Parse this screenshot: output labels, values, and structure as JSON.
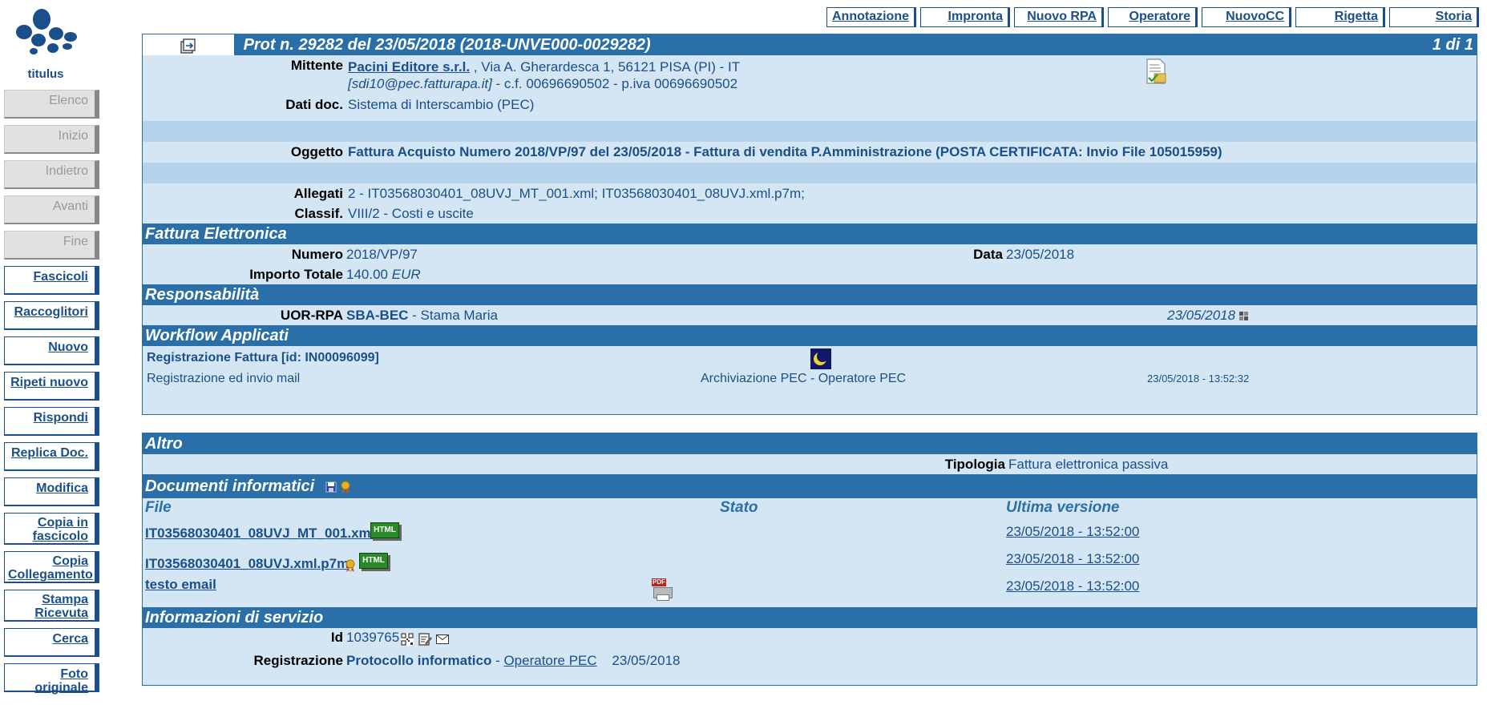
{
  "app": {
    "logo_text": "titulus"
  },
  "sidebar": {
    "disabled": [
      {
        "label": "Elenco"
      },
      {
        "label": "Inizio"
      },
      {
        "label": "Indietro"
      },
      {
        "label": "Avanti"
      },
      {
        "label": "Fine"
      }
    ],
    "actions": [
      {
        "label": "Fascicoli"
      },
      {
        "label": "Raccoglitori"
      },
      {
        "label": "Nuovo"
      },
      {
        "label": "Ripeti nuovo"
      },
      {
        "label": "Rispondi"
      },
      {
        "label": "Replica Doc."
      },
      {
        "label": "Modifica"
      },
      {
        "label": "Copia in fascicolo"
      },
      {
        "label": "Copia Collegamento"
      },
      {
        "label": "Stampa Ricevuta"
      },
      {
        "label": "Cerca"
      },
      {
        "label": "Foto originale"
      }
    ]
  },
  "toolbar": {
    "buttons": [
      {
        "label": "Annotazione"
      },
      {
        "label": "Impronta"
      },
      {
        "label": "Nuovo RPA"
      },
      {
        "label": "Operatore"
      },
      {
        "label": "NuovoCC"
      },
      {
        "label": "Rigetta"
      },
      {
        "label": "Storia"
      }
    ]
  },
  "record": {
    "title": "Prot n. 29282 del 23/05/2018  (2018-UNVE000-0029282)",
    "pager": "1 di 1",
    "mittente_label": "Mittente",
    "mittente_name": "Pacini Editore s.r.l.",
    "mittente_address": ", Via A. Gherardesca 1, 56121 PISA (PI) - IT",
    "mittente_email": "[sdi10@pec.fatturapa.it]",
    "mittente_ids": " - c.f. 00696690502 - p.iva 00696690502",
    "datidoc_label": "Dati doc.",
    "datidoc_value": "Sistema di Interscambio (PEC)",
    "oggetto_label": "Oggetto",
    "oggetto_value": "Fattura Acquisto Numero 2018/VP/97 del 23/05/2018 - Fattura di vendita P.Amministrazione (POSTA CERTIFICATA: Invio File 105015959)",
    "allegati_label": "Allegati",
    "allegati_value": "2 -  IT03568030401_08UVJ_MT_001.xml; IT03568030401_08UVJ.xml.p7m;",
    "classif_label": "Classif.",
    "classif_value": "VIII/2 - Costi e uscite"
  },
  "fattura": {
    "header": "Fattura Elettronica",
    "numero_label": "Numero",
    "numero_value": "2018/VP/97",
    "data_label": "Data",
    "data_value": "23/05/2018",
    "importo_label": "Importo Totale",
    "importo_value": "140.00",
    "importo_currency": "EUR"
  },
  "responsabilita": {
    "header": "Responsabilità",
    "uor_label": "UOR-RPA",
    "uor_code": "SBA-BEC",
    "uor_person": " - Stama Maria",
    "date": "23/05/2018"
  },
  "workflow": {
    "header": "Workflow Applicati",
    "name": "Registrazione Fattura [id: IN00096099]",
    "step": "Registrazione ed invio mail",
    "operator": "Archiviazione PEC - Operatore PEC",
    "timestamp": "23/05/2018  -  13:52:32"
  },
  "altro": {
    "header": "Altro",
    "tipologia_label": "Tipologia",
    "tipologia_value": "Fattura elettronica passiva"
  },
  "documenti": {
    "header": "Documenti informatici",
    "columns": [
      "File",
      "Stato",
      "Ultima versione"
    ],
    "files": [
      {
        "name": "IT03568030401_08UVJ_MT_001.xml",
        "version": "23/05/2018 - 13:52:00"
      },
      {
        "name": "IT03568030401_08UVJ.xml.p7m",
        "version": "23/05/2018 - 13:52:00"
      },
      {
        "name": "testo email",
        "version": "23/05/2018 - 13:52:00"
      }
    ],
    "badge_text": "HTML",
    "pdf_text": "PDF"
  },
  "servizio": {
    "header": "Informazioni di servizio",
    "id_label": "Id",
    "id_value": "1039765",
    "reg_label": "Registrazione",
    "reg_value": "Protocollo informatico",
    "reg_sep": " - ",
    "reg_operator": "Operatore PEC",
    "reg_date": "23/05/2018"
  },
  "colors": {
    "primary": "#2a6fa8",
    "panel_bg": "#d4e6f4",
    "strip": "#b5d4ec",
    "link": "#1a4f8b"
  }
}
